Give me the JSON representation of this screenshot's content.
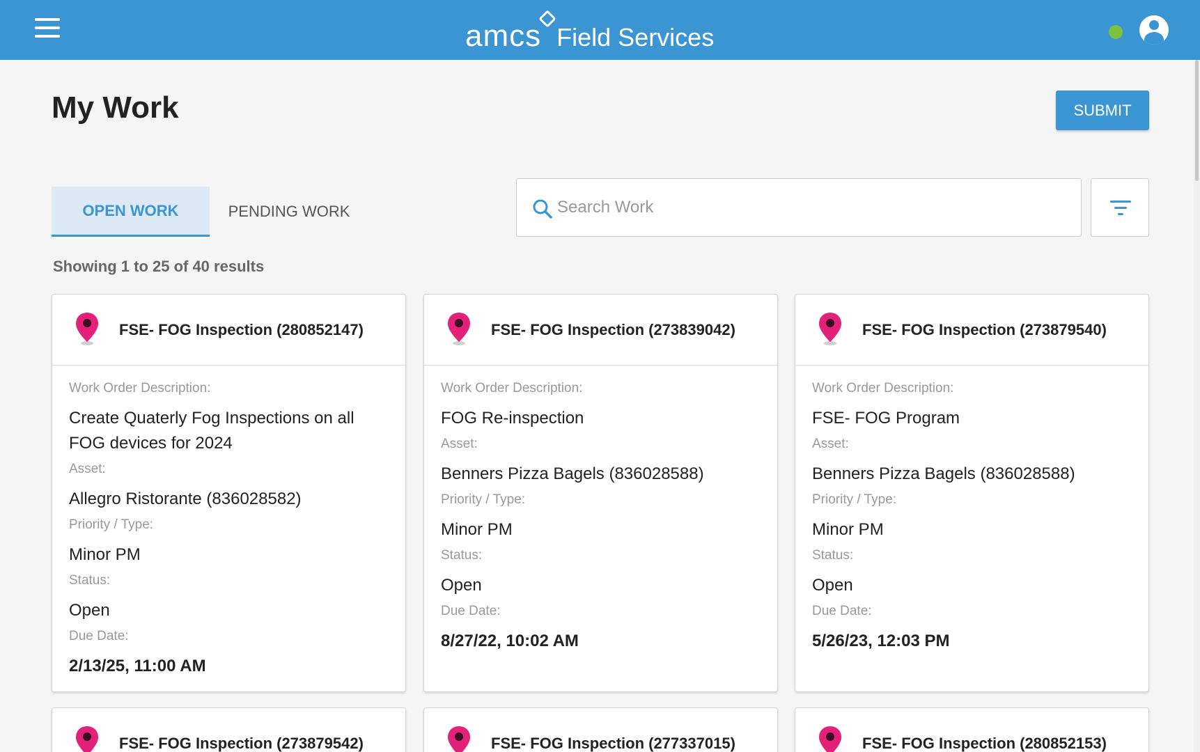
{
  "header": {
    "logo_text": "amcs",
    "app_name": "Field Services",
    "accent_color": "#3b95d3",
    "status_color": "#7cc142",
    "menu_icon": "hamburger-menu-icon",
    "user_icon": "user-account-icon"
  },
  "page": {
    "title": "My Work",
    "submit_label": "SUBMIT"
  },
  "tabs": [
    {
      "label": "OPEN WORK",
      "active": true
    },
    {
      "label": "PENDING WORK",
      "active": false
    }
  ],
  "search": {
    "placeholder": "Search Work",
    "value": ""
  },
  "results_text": "Showing 1 to 25 of 40 results",
  "labels": {
    "description": "Work Order Description:",
    "asset": "Asset:",
    "priority": "Priority / Type:",
    "status": "Status:",
    "due": "Due Date:"
  },
  "cards": [
    {
      "title": "FSE- FOG Inspection (280852147)",
      "description": "Create Quaterly Fog Inspections on all FOG devices for 2024",
      "asset": "Allegro Ristorante (836028582)",
      "priority": "Minor PM",
      "status": "Open",
      "due": "2/13/25, 11:00 AM"
    },
    {
      "title": "FSE- FOG Inspection (273839042)",
      "description": "FOG Re-inspection",
      "asset": "Benners Pizza Bagels (836028588)",
      "priority": "Minor PM",
      "status": "Open",
      "due": "8/27/22, 10:02 AM"
    },
    {
      "title": "FSE- FOG Inspection (273879540)",
      "description": "FSE- FOG Program",
      "asset": "Benners Pizza Bagels (836028588)",
      "priority": "Minor PM",
      "status": "Open",
      "due": "5/26/23, 12:03 PM"
    },
    {
      "title": "FSE- FOG Inspection (273879542)"
    },
    {
      "title": "FSE- FOG Inspection (277337015)"
    },
    {
      "title": "FSE- FOG Inspection (280852153)"
    }
  ]
}
